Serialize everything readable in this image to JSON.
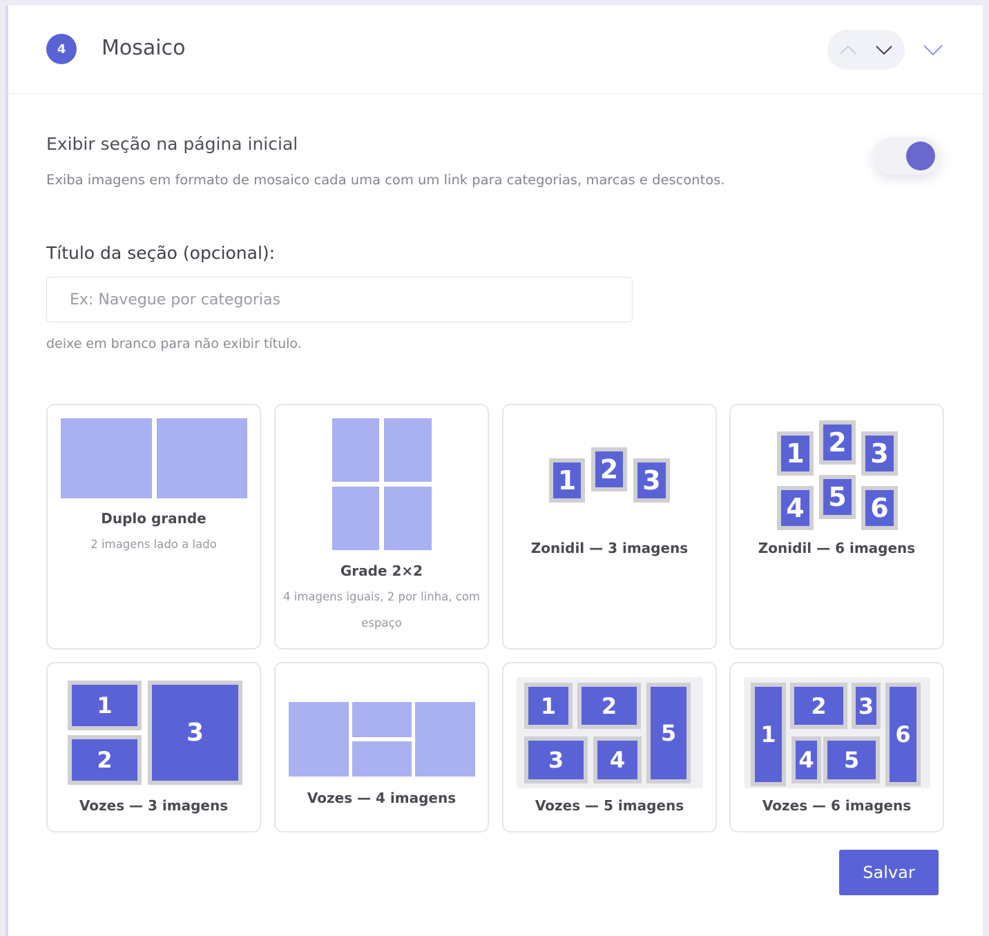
{
  "header": {
    "step": "4",
    "title": "Mosaico"
  },
  "icons": {
    "move_up": "chevron-up-icon",
    "move_down": "chevron-down-icon",
    "collapse": "chevron-down-icon"
  },
  "visibility": {
    "title": "Exibir seção na página inicial",
    "description": "Exiba imagens em formato de mosaico cada uma com um link para categorias, marcas e descontos.",
    "enabled": true
  },
  "section_title": {
    "label": "Título da seção (opcional):",
    "value": "",
    "placeholder": "Ex: Navegue por categorias",
    "hint": "deixe em branco para não exibir título."
  },
  "layouts": [
    {
      "name": "Duplo grande",
      "subtitle": "2 imagens lado a lado"
    },
    {
      "name": "Grade 2×2",
      "subtitle": "4 imagens iguais, 2 por linha, com espaço"
    },
    {
      "name": "Zonidil — 3 imagens",
      "numbers": [
        "1",
        "2",
        "3"
      ]
    },
    {
      "name": "Zonidil — 6 imagens",
      "numbers": [
        "1",
        "2",
        "3",
        "4",
        "5",
        "6"
      ]
    },
    {
      "name": "Vozes — 3 imagens",
      "numbers": [
        "1",
        "2",
        "3"
      ]
    },
    {
      "name": "Vozes — 4 imagens"
    },
    {
      "name": "Vozes — 5 imagens",
      "numbers": [
        "1",
        "2",
        "3",
        "4",
        "5"
      ]
    },
    {
      "name": "Vozes — 6 imagens",
      "numbers": [
        "1",
        "2",
        "3",
        "4",
        "5",
        "6"
      ]
    }
  ],
  "colors": {
    "accent": "#5a63d6",
    "light_block": "#a9b1f1",
    "toggle_knob": "#6a68cf"
  },
  "actions": {
    "save_label": "Salvar"
  }
}
